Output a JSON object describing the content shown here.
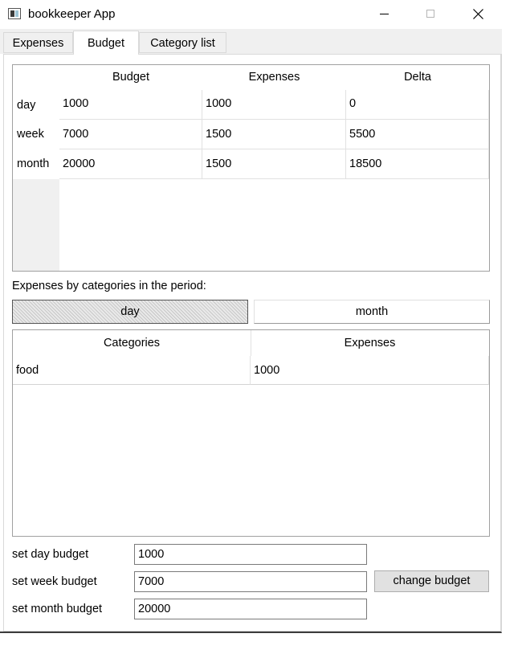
{
  "window": {
    "title": "bookkeeper App"
  },
  "tabs": [
    {
      "label": "Expenses"
    },
    {
      "label": "Budget"
    },
    {
      "label": "Category list"
    }
  ],
  "budget_table": {
    "headers": [
      "Budget",
      "Expenses",
      "Delta"
    ],
    "rows": [
      {
        "label": "day",
        "budget": "1000",
        "expenses": "1000",
        "delta": "0"
      },
      {
        "label": "week",
        "budget": "7000",
        "expenses": "1500",
        "delta": "5500"
      },
      {
        "label": "month",
        "budget": "20000",
        "expenses": "1500",
        "delta": "18500"
      }
    ]
  },
  "period_label": "Expenses by categories in the period:",
  "period_buttons": {
    "day": "day",
    "month": "month"
  },
  "category_table": {
    "headers": [
      "Categories",
      "Expenses"
    ],
    "rows": [
      {
        "category": "food",
        "expenses": "1000"
      }
    ]
  },
  "form": {
    "day_label": "set day budget",
    "week_label": "set week budget",
    "month_label": "set month budget",
    "day_value": "1000",
    "week_value": "7000",
    "month_value": "20000",
    "change_button": "change budget"
  }
}
